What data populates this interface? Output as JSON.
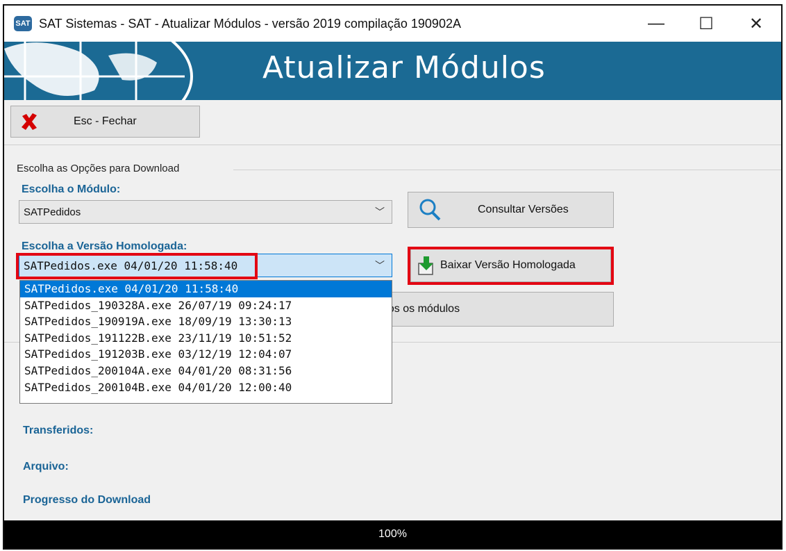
{
  "window": {
    "title": "SAT Sistemas - SAT - Atualizar Módulos - versão 2019 compilação 190902A",
    "icon_text": "SAT",
    "controls": {
      "minimize": "—",
      "maximize": "☐",
      "close": "✕"
    }
  },
  "banner": {
    "title": "Atualizar Módulos"
  },
  "toolbar": {
    "close_label": "Esc - Fechar",
    "close_icon": "red-x-icon"
  },
  "download_options": {
    "group_label": "Escolha as Opções para Download",
    "module_label": "Escolha o Módulo:",
    "module_value": "SATPedidos",
    "version_label": "Escolha a Versão Homologada:",
    "version_value": "SATPedidos.exe 04/01/20 11:58:40",
    "versions": [
      "SATPedidos.exe 04/01/20 11:58:40",
      "SATPedidos_190328A.exe 26/07/19 09:24:17",
      "SATPedidos_190919A.exe 18/09/19 13:30:13",
      "SATPedidos_191122B.exe 23/11/19 10:51:52",
      "SATPedidos_191203B.exe 03/12/19 12:04:07",
      "SATPedidos_200104A.exe 04/01/20 08:31:56",
      "SATPedidos_200104B.exe 04/01/20 12:00:40"
    ],
    "consult_label": "Consultar Versões",
    "download_label": "Baixar Versão Homologada",
    "all_modules_label": "dos os módulos"
  },
  "status": {
    "transferred_label": "Transferidos:",
    "file_label": "Arquivo:",
    "progress_label": "Progresso do Download",
    "progress_value": "100%"
  },
  "colors": {
    "banner": "#1b6a94",
    "label": "#1a6496",
    "highlight": "#e30613",
    "selection": "#0078d7"
  }
}
